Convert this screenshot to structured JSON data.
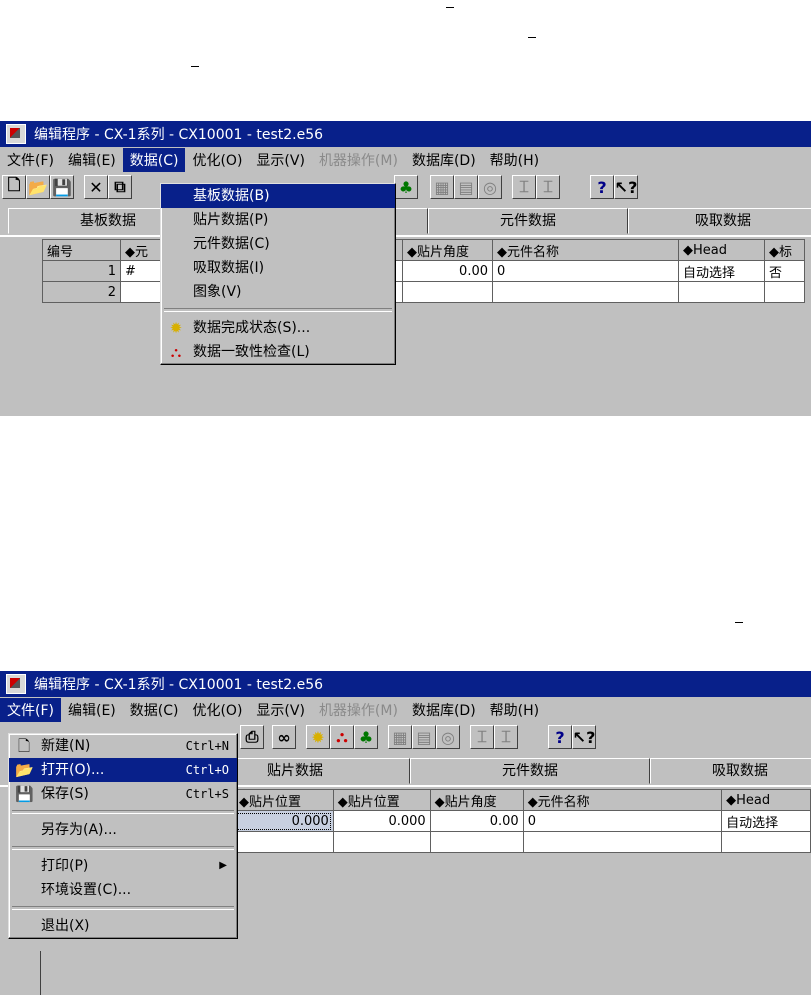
{
  "window": {
    "title": "编辑程序  -  CX-1系列  - CX10001 - test2.e56"
  },
  "menubar": [
    "文件(F)",
    "编辑(E)",
    "数据(C)",
    "优化(O)",
    "显示(V)",
    "机器操作(M)",
    "数据库(D)",
    "帮助(H)"
  ],
  "data_menu": {
    "items": [
      "基板数据(B)",
      "贴片数据(P)",
      "元件数据(C)",
      "吸取数据(I)",
      "图象(V)"
    ],
    "tools": [
      "数据完成状态(S)...",
      "数据一致性检查(L)"
    ]
  },
  "file_menu": {
    "items": [
      {
        "label": "新建(N)",
        "shortcut": "Ctrl+N"
      },
      {
        "label": "打开(O)...",
        "shortcut": "Ctrl+O"
      },
      {
        "label": "保存(S)",
        "shortcut": "Ctrl+S"
      },
      {
        "label": "另存为(A)...",
        "shortcut": ""
      },
      {
        "label": "打印(P)",
        "shortcut": ""
      },
      {
        "label": "环境设置(C)...",
        "shortcut": ""
      },
      {
        "label": "退出(X)",
        "shortcut": ""
      }
    ]
  },
  "tabs": [
    "基板数据",
    "贴片数据",
    "元件数据",
    "吸取数据"
  ],
  "grid1": {
    "headers": [
      "编号",
      "◆元",
      "◆贴片角度",
      "◆元件名称",
      "◆Head",
      "◆标"
    ],
    "row1": {
      "num": "1",
      "c1": "#",
      "angle": "0.00",
      "name": "0",
      "head": "自动选择",
      "flag": "否"
    },
    "row2": {
      "num": "2"
    }
  },
  "grid2": {
    "headers": [
      "◆贴片位置",
      "◆贴片位置",
      "◆贴片角度",
      "◆元件名称",
      "◆Head"
    ],
    "row1": {
      "x": "0.000",
      "y": "0.000",
      "angle": "0.00",
      "name": "0",
      "head": "自动选择"
    }
  },
  "colors": {
    "titlebar": "#08208a",
    "face": "#c0c0c0",
    "highlight": "#08208a"
  }
}
